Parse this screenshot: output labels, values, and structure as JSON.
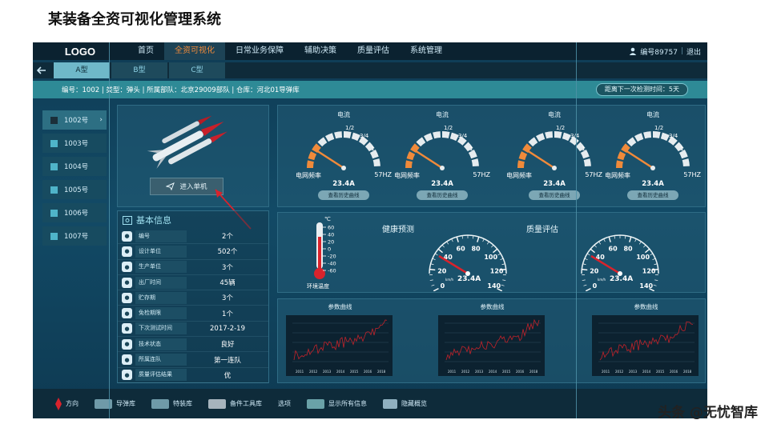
{
  "slide_title": "某装备全资可视化管理系统",
  "nav": {
    "logo": "LOGO",
    "items": [
      "首页",
      "全资可视化",
      "日常业务保障",
      "辅助决策",
      "质量评估",
      "系统管理"
    ],
    "active_index": 1,
    "user_label": "编号89757",
    "logout": "退出"
  },
  "type_tabs": [
    "A型",
    "B型",
    "C型"
  ],
  "info_bar": {
    "text": "编号：1002 | 类型：弹头 | 所属部队：北京29009部队 | 仓库：河北01导弹库",
    "next_check": "距离下一次检测时间：5天"
  },
  "devices": [
    "1002号",
    "1003号",
    "1004号",
    "1005号",
    "1006号",
    "1007号"
  ],
  "enter_button": "进入单机",
  "basic_info": {
    "title": "基本信息",
    "rows": [
      {
        "label": "编号",
        "value": "2个"
      },
      {
        "label": "设计单位",
        "value": "502个"
      },
      {
        "label": "生产单位",
        "value": "3个"
      },
      {
        "label": "出厂时间",
        "value": "45辆"
      },
      {
        "label": "贮存期",
        "value": "3个"
      },
      {
        "label": "免检期限",
        "value": "1个"
      },
      {
        "label": "下次测试时间",
        "value": "2017-2-19"
      },
      {
        "label": "技术状态",
        "value": "良好"
      },
      {
        "label": "所属连队",
        "value": "第一连队"
      },
      {
        "label": "质量评估结果",
        "value": "优"
      }
    ]
  },
  "current_gauges": [
    {
      "title": "电流",
      "freq_label": "电网频率",
      "hz": "57HZ",
      "value": "23.4A",
      "button": "查看历史曲线",
      "ticks": [
        "1/2",
        "3/4",
        "1"
      ]
    },
    {
      "title": "电流",
      "freq_label": "电网频率",
      "hz": "57HZ",
      "value": "23.4A",
      "button": "查看历史曲线",
      "ticks": [
        "1/2",
        "3/4",
        "1"
      ]
    },
    {
      "title": "电流",
      "freq_label": "电网频率",
      "hz": "57HZ",
      "value": "23.4A",
      "button": "查看历史曲线",
      "ticks": [
        "1/2",
        "3/4",
        "1"
      ]
    },
    {
      "title": "电流",
      "freq_label": "电网频率",
      "hz": "57HZ",
      "value": "23.4A",
      "button": "查看历史曲线",
      "ticks": [
        "1/2",
        "3/4",
        "1"
      ]
    }
  ],
  "thermometer": {
    "unit": "℃",
    "ticks": [
      "60",
      "40",
      "20",
      "0",
      "-20",
      "-40",
      "-60"
    ],
    "label": "环境温度"
  },
  "health": {
    "label_left": "健康预测",
    "label_right": "质量评估",
    "speedo_ticks": [
      "0",
      "20",
      "40",
      "60",
      "80",
      "100",
      "120",
      "140"
    ],
    "value": "23.4A",
    "unit_small": "km/h"
  },
  "curves": {
    "title": "参数曲线",
    "years": [
      "2011",
      "2012",
      "2013",
      "2014",
      "2015",
      "2016",
      "2018"
    ]
  },
  "toolbar": [
    "方向",
    "导弹库",
    "特装库",
    "备件工具库",
    "选项",
    "显示所有信息",
    "隐藏概览"
  ],
  "watermark": "头条 @无忧智库",
  "colors": {
    "accent_orange": "#f08a3a",
    "teal_bar": "#2e8a96",
    "needle_red": "#d9232c",
    "missile_red": "#c8202a"
  }
}
